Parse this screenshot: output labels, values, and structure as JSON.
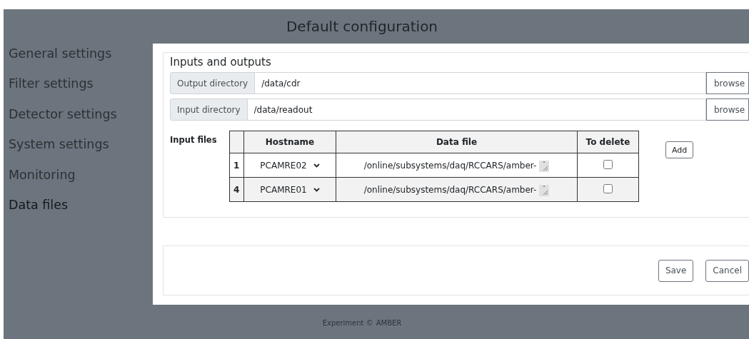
{
  "title": "Default configuration",
  "sidebar": {
    "items": [
      {
        "label": "General settings",
        "selected": false
      },
      {
        "label": "Filter settings",
        "selected": false
      },
      {
        "label": "Detector settings",
        "selected": false
      },
      {
        "label": "System settings",
        "selected": false
      },
      {
        "label": "Monitoring",
        "selected": false
      },
      {
        "label": "Data files",
        "selected": true
      }
    ]
  },
  "section": {
    "title": "Inputs and outputs",
    "directories": [
      {
        "label": "Output directory",
        "value": "/data/cdr",
        "button": "browse"
      },
      {
        "label": "Input directory",
        "value": "/data/readout",
        "button": "browse"
      }
    ],
    "input_files": {
      "label": "Input files",
      "columns": [
        "Hostname",
        "Data file",
        "To delete"
      ],
      "rows": [
        {
          "index": "1",
          "hostname": "PCAMRE02",
          "data_file": "/online/subsystems/daq/RCCARS/amber-",
          "to_delete": false
        },
        {
          "index": "4",
          "hostname": "PCAMRE01",
          "data_file": "/online/subsystems/daq/RCCARS/amber-",
          "to_delete": false
        }
      ],
      "add_button": "Add"
    }
  },
  "actions": [
    "Save",
    "Cancel"
  ],
  "footer": {
    "text": "Experiment ©",
    "brand": "AMBER"
  }
}
